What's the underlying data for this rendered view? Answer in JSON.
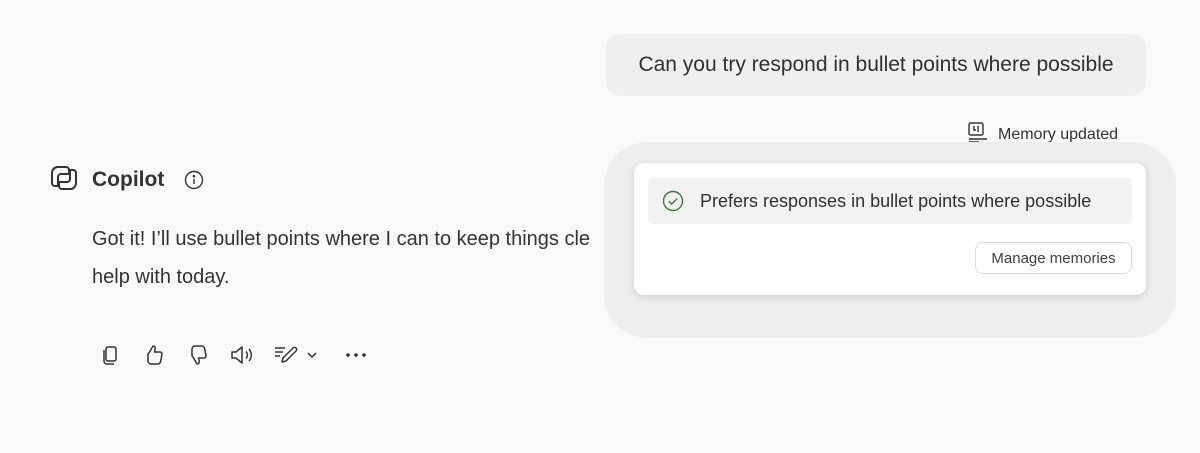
{
  "user_message": "Can you try respond in bullet points where possible",
  "memory_notice": {
    "icon": "memory-icon",
    "label": "Memory updated"
  },
  "assistant": {
    "name": "Copilot",
    "logo_icon": "copilot-logo-icon",
    "info_icon": "info-icon",
    "reply_line1": "Got it! I’ll use bullet points where I can to keep things cle",
    "reply_line2": "help with today."
  },
  "actions": [
    {
      "name": "copy",
      "icon": "copy-icon"
    },
    {
      "name": "thumbs-up",
      "icon": "thumbs-up-icon"
    },
    {
      "name": "thumbs-down",
      "icon": "thumbs-down-icon"
    },
    {
      "name": "read-aloud",
      "icon": "speaker-icon"
    },
    {
      "name": "edit",
      "icon": "edit-icon"
    },
    {
      "name": "edit-options",
      "icon": "chevron-down-icon"
    },
    {
      "name": "more",
      "icon": "more-icon"
    }
  ],
  "memory_popup": {
    "item_icon": "check-circle-icon",
    "item_text": "Prefers responses in bullet points where possible",
    "button_label": "Manage memories",
    "check_color": "#3e7a3e"
  }
}
